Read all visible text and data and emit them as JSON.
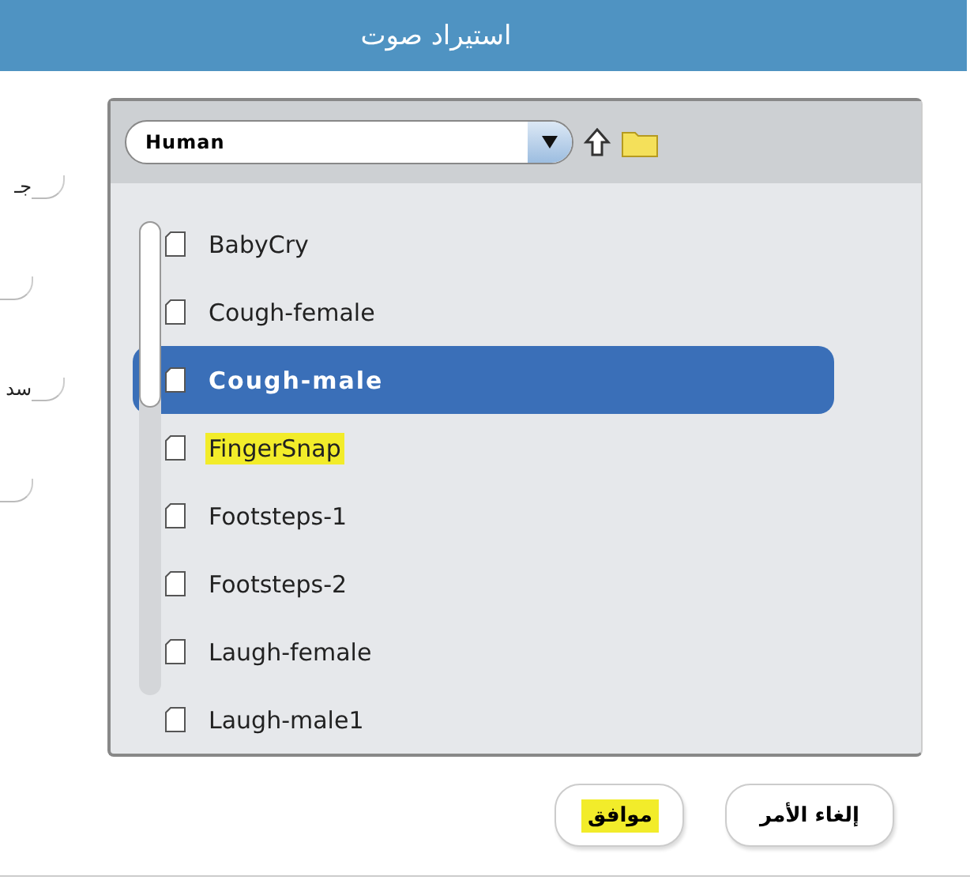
{
  "window": {
    "title": "استيراد صوت"
  },
  "side_fields": [
    {
      "kind": "labeled",
      "label": "جـ"
    },
    {
      "kind": "plain"
    },
    {
      "kind": "labeled",
      "label": "سد"
    },
    {
      "kind": "plain"
    }
  ],
  "location": {
    "value": "Human"
  },
  "files": [
    {
      "name": "BabyCry",
      "selected": false,
      "highlighted": false
    },
    {
      "name": "Cough-female",
      "selected": false,
      "highlighted": false
    },
    {
      "name": "Cough-male",
      "selected": true,
      "highlighted": false
    },
    {
      "name": "FingerSnap",
      "selected": false,
      "highlighted": true
    },
    {
      "name": "Footsteps-1",
      "selected": false,
      "highlighted": false
    },
    {
      "name": "Footsteps-2",
      "selected": false,
      "highlighted": false
    },
    {
      "name": "Laugh-female",
      "selected": false,
      "highlighted": false
    },
    {
      "name": "Laugh-male1",
      "selected": false,
      "highlighted": false
    }
  ],
  "buttons": [
    {
      "kind": "cancel",
      "label": "إلغاء الأمر",
      "highlighted": false
    },
    {
      "kind": "ok",
      "label": "موافق",
      "highlighted": true
    }
  ]
}
